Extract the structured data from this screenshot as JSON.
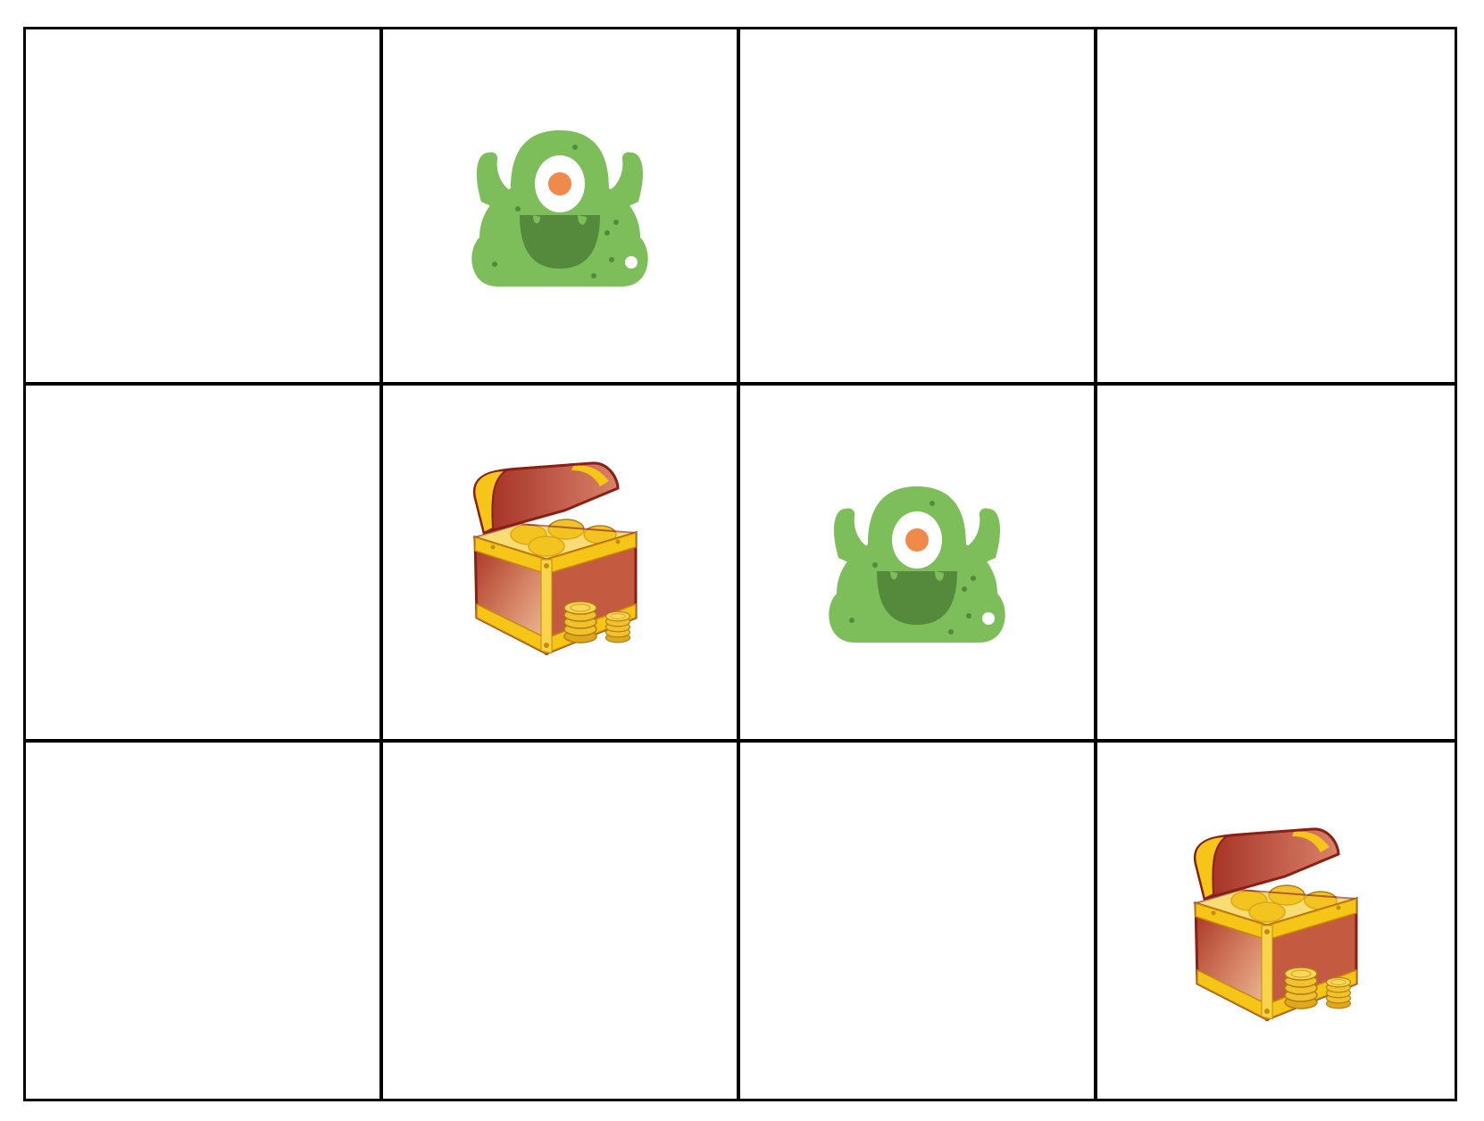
{
  "board": {
    "rows": 3,
    "cols": 4,
    "cells": [
      [
        "empty",
        "monster",
        "empty",
        "empty"
      ],
      [
        "empty",
        "treasure",
        "monster",
        "empty"
      ],
      [
        "empty",
        "empty",
        "empty",
        "treasure"
      ]
    ]
  },
  "pieces": {
    "monster": {
      "icon": "green-one-eyed-monster-icon",
      "body_color": "#7dbe5a",
      "mouth_color": "#558a3c",
      "eye_color": "#f08a4b"
    },
    "treasure": {
      "icon": "treasure-chest-icon",
      "box_color": "#b8402a",
      "trim_color": "#f5c518",
      "coin_color": "#f2c12e"
    }
  },
  "colors": {
    "grid_line": "#000000",
    "background": "#ffffff"
  }
}
